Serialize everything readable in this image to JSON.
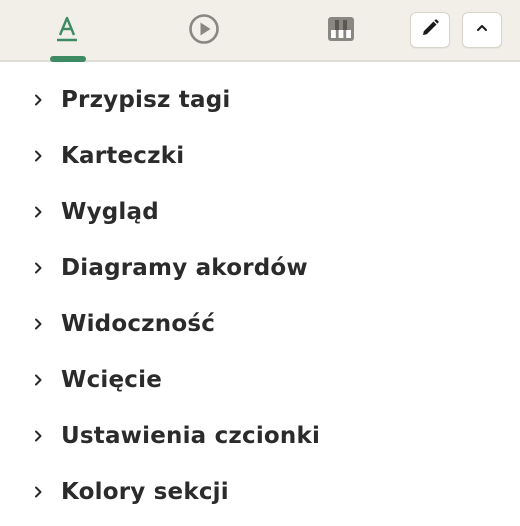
{
  "toolbar": {
    "tabs": [
      {
        "icon": "text-format-icon",
        "active": true
      },
      {
        "icon": "play-circle-icon",
        "active": false
      },
      {
        "icon": "piano-keys-icon",
        "active": false
      }
    ],
    "buttons": [
      {
        "icon": "pencil-icon"
      },
      {
        "icon": "chevron-up-icon"
      }
    ],
    "accent_color": "#3e8a62",
    "inactive_icon_color": "#8a8782"
  },
  "menu": {
    "items": [
      {
        "label": "Przypisz tagi"
      },
      {
        "label": "Karteczki"
      },
      {
        "label": "Wygląd"
      },
      {
        "label": "Diagramy akordów"
      },
      {
        "label": "Widoczność"
      },
      {
        "label": "Wcięcie"
      },
      {
        "label": "Ustawienia czcionki"
      },
      {
        "label": "Kolory sekcji"
      }
    ]
  }
}
